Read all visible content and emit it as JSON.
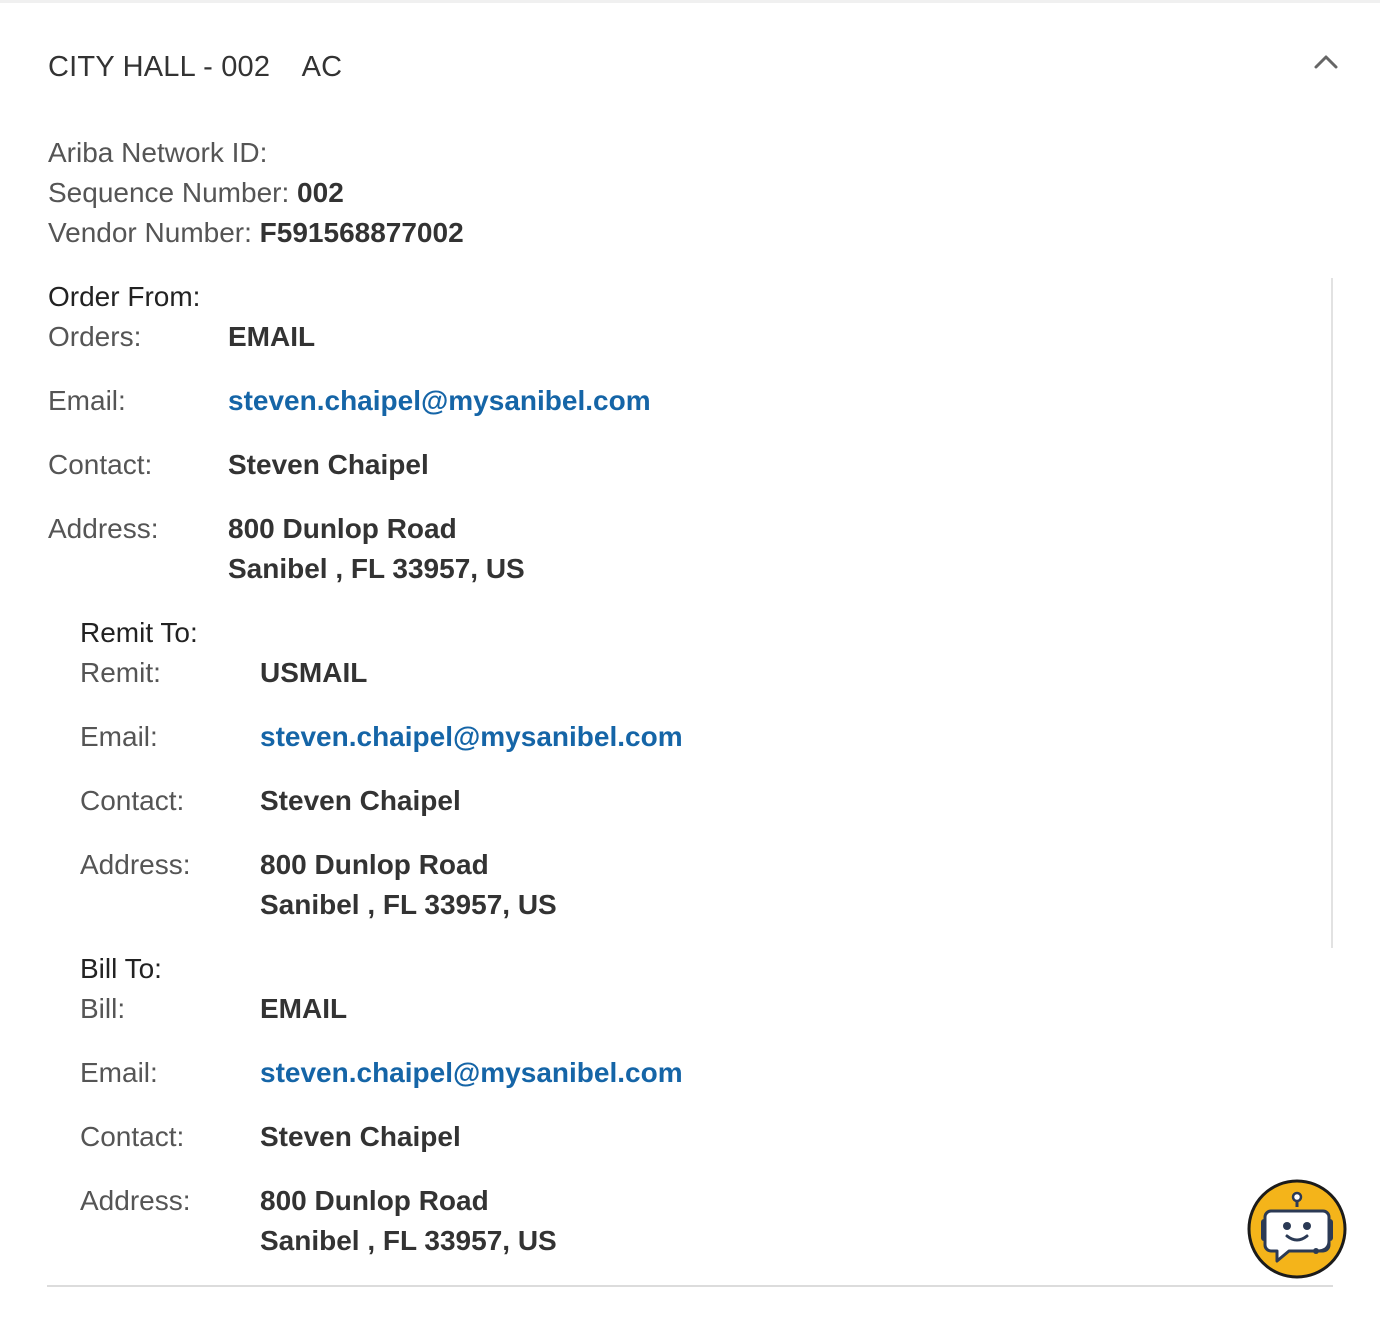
{
  "header": {
    "title": "CITY HALL - 002    AC",
    "collapse_icon": "chevron-up-icon"
  },
  "meta": {
    "ariba_label": "Ariba Network ID:",
    "ariba_value": "",
    "sequence_label": "Sequence Number:",
    "sequence_value": "002",
    "vendor_label": "Vendor Number:",
    "vendor_value": "F591568877002"
  },
  "order_from": {
    "title": "Order From:",
    "method_label": "Orders:",
    "method_value": "EMAIL",
    "email_label": "Email:",
    "email_value": "steven.chaipel@mysanibel.com",
    "contact_label": "Contact:",
    "contact_value": "Steven Chaipel",
    "address_label": "Address:",
    "address_line1": "800 Dunlop Road",
    "address_line2": "Sanibel , FL 33957, US"
  },
  "remit_to": {
    "title": "Remit To:",
    "method_label": "Remit:",
    "method_value": "USMAIL",
    "email_label": "Email:",
    "email_value": "steven.chaipel@mysanibel.com",
    "contact_label": "Contact:",
    "contact_value": "Steven Chaipel",
    "address_label": "Address:",
    "address_line1": "800 Dunlop Road",
    "address_line2": "Sanibel , FL 33957, US"
  },
  "bill_to": {
    "title": "Bill To:",
    "method_label": "Bill:",
    "method_value": "EMAIL",
    "email_label": "Email:",
    "email_value": "steven.chaipel@mysanibel.com",
    "contact_label": "Contact:",
    "contact_value": "Steven Chaipel",
    "address_label": "Address:",
    "address_line1": "800 Dunlop Road",
    "address_line2": "Sanibel , FL 33957, US"
  },
  "chatbot": {
    "icon": "chatbot-robot-icon",
    "accent_color": "#f4b41a"
  },
  "colors": {
    "link": "#1565a7",
    "text": "#333333",
    "label": "#555555"
  }
}
